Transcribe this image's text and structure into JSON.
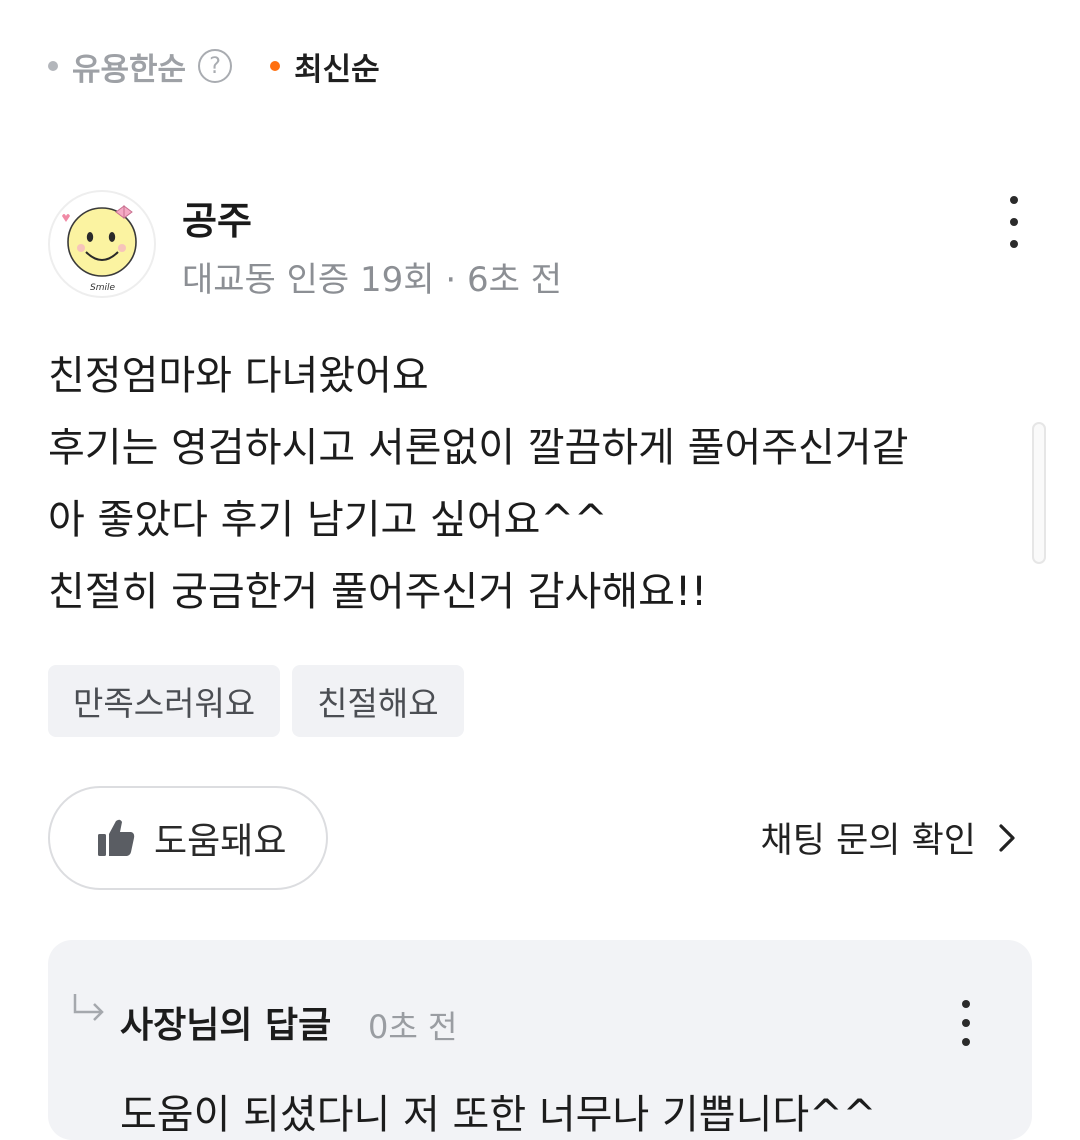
{
  "sort": {
    "options": [
      {
        "label": "유용한순",
        "active": false
      },
      {
        "label": "최신순",
        "active": true
      }
    ],
    "help_glyph": "?"
  },
  "review": {
    "author": "공주",
    "meta": "대교동 인증 19회 · 6초 전",
    "avatar_icon": "smiley-face-avatar",
    "body_lines": [
      "친정엄마와 다녀왔어요",
      "후기는 영검하시고 서론없이 깔끔하게 풀어주신거같",
      "아 좋았다 후기 남기고 싶어요^^",
      "친절히 궁금한거 풀어주신거 감사해요!!"
    ],
    "tags": [
      "만족스러워요",
      "친절해요"
    ],
    "helpful_label": "도움돼요",
    "chat_link_label": "채팅 문의 확인"
  },
  "reply": {
    "title": "사장님의 답글",
    "time": "0초 전",
    "text": "도움이 되셨다니 저 또한 너무나 기쁩니다^^"
  },
  "colors": {
    "accent": "#ff6f0f",
    "muted": "#9ea1a6",
    "tag_bg": "#f1f2f5",
    "reply_bg": "#f2f3f6"
  }
}
